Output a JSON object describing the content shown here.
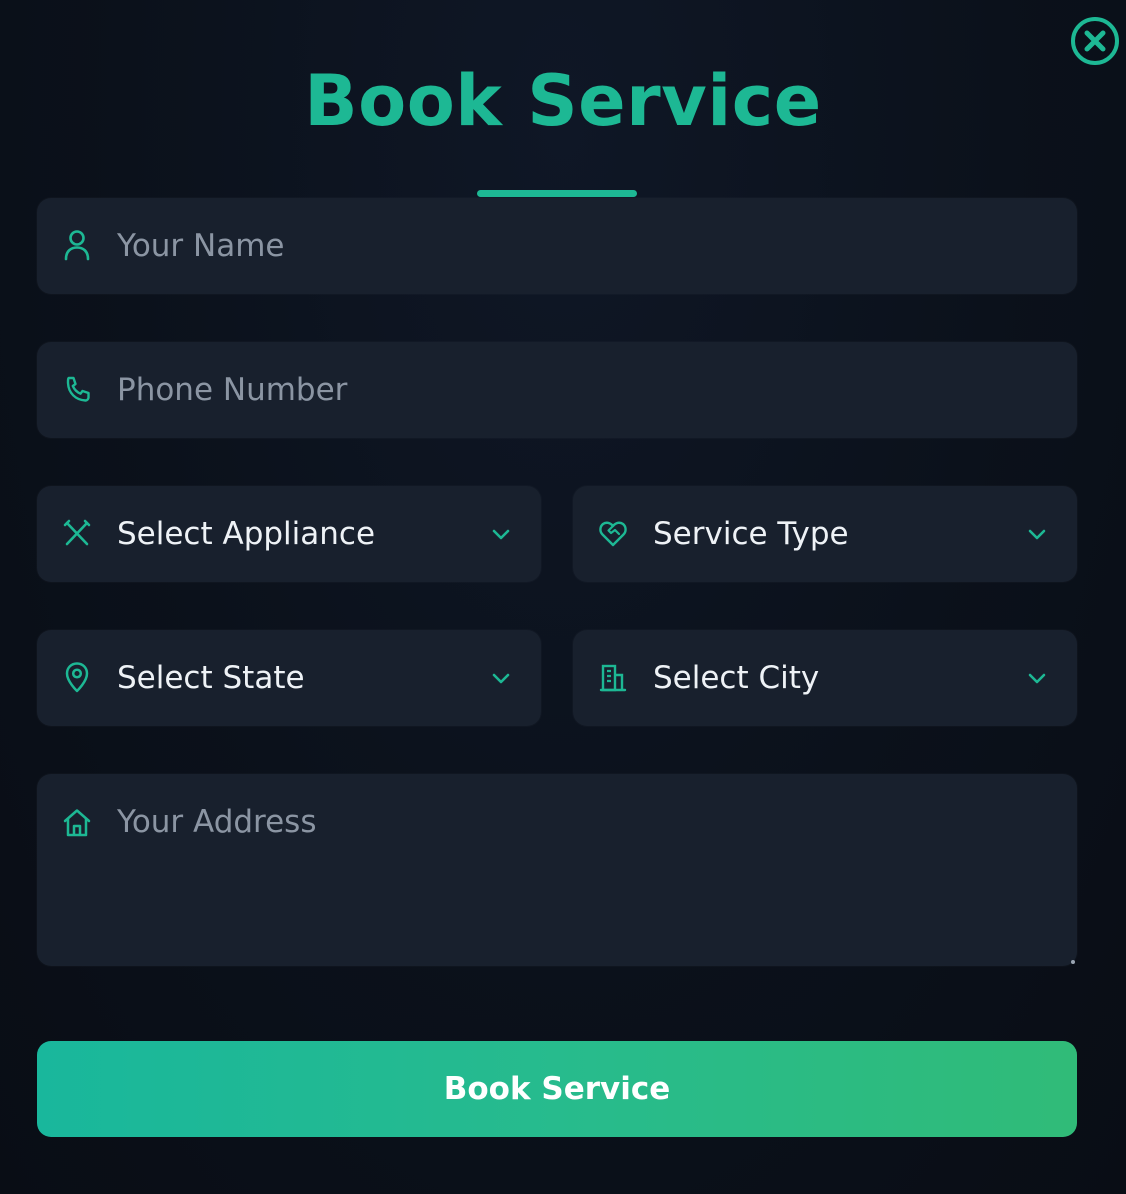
{
  "modal": {
    "title": "Book Service",
    "close_icon": "close-circle-icon",
    "accent_color": "#1db894"
  },
  "fields": {
    "name": {
      "placeholder": "Your Name",
      "icon": "user-icon"
    },
    "phone": {
      "placeholder": "Phone Number",
      "icon": "phone-icon"
    },
    "appliance": {
      "selected": "Select Appliance",
      "icon": "tools-icon"
    },
    "service_type": {
      "selected": "Service Type",
      "icon": "heart-handshake-icon"
    },
    "state": {
      "selected": "Select State",
      "icon": "map-pin-icon"
    },
    "city": {
      "selected": "Select City",
      "icon": "building-icon"
    },
    "address": {
      "placeholder": "Your Address",
      "icon": "home-icon"
    }
  },
  "submit": {
    "label": "Book Service"
  }
}
